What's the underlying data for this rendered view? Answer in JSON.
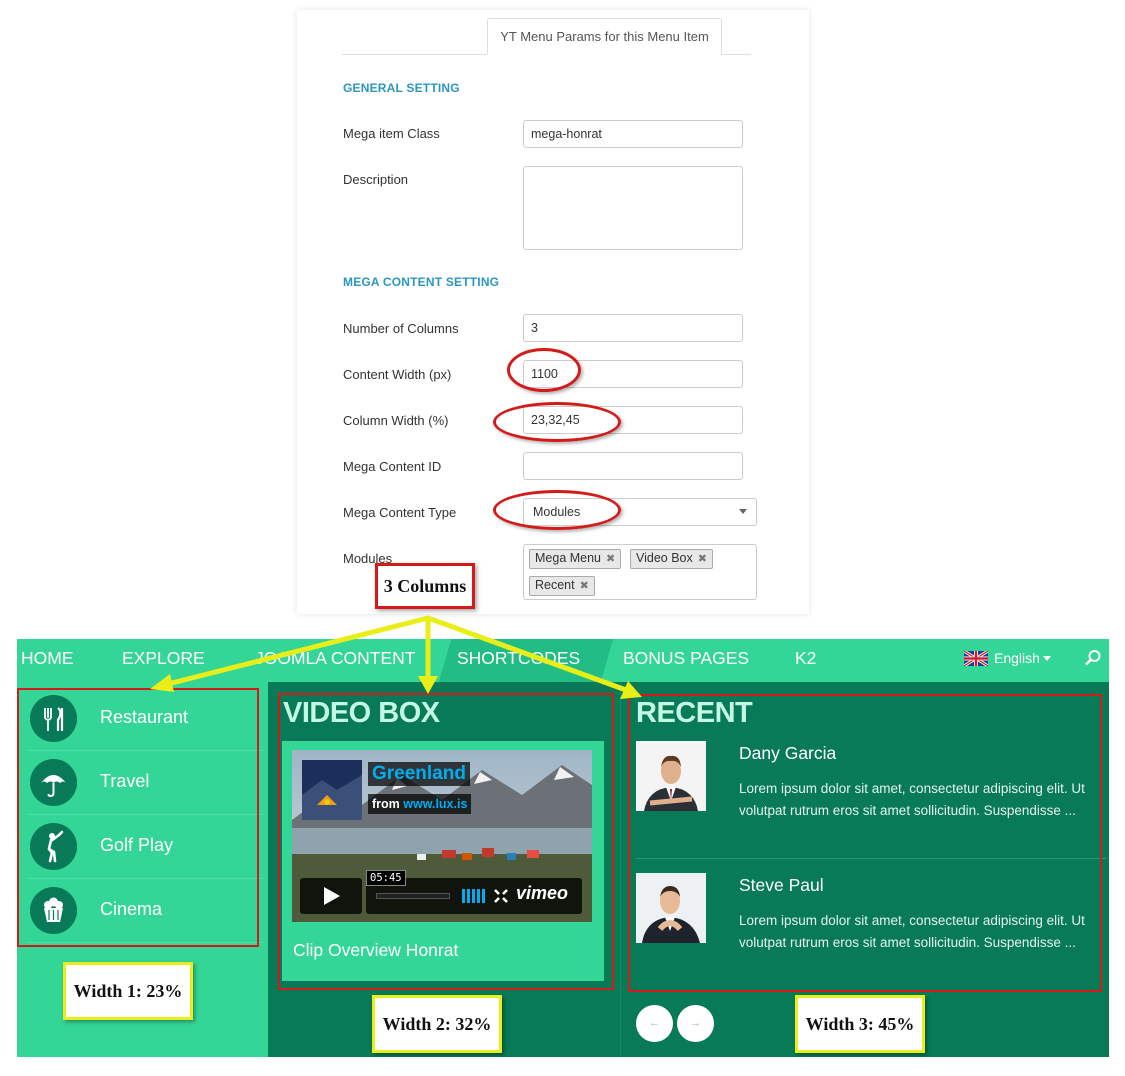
{
  "admin": {
    "tab_label": "YT Menu Params for this Menu Item",
    "general_heading": "GENERAL SETTING",
    "mega_item_class_label": "Mega item Class",
    "mega_item_class_value": "mega-honrat",
    "description_label": "Description",
    "description_value": "",
    "mega_content_heading": "MEGA CONTENT SETTING",
    "num_columns_label": "Number of Columns",
    "num_columns_value": "3",
    "content_width_label": "Content Width (px)",
    "content_width_value": "1100",
    "column_width_label": "Column Width (%)",
    "column_width_value": "23,32,45",
    "mega_content_id_label": "Mega Content ID",
    "mega_content_id_value": "",
    "mega_content_type_label": "Mega Content Type",
    "mega_content_type_value": "Modules",
    "modules_label": "Modules",
    "modules": [
      "Mega Menu",
      "Video Box",
      "Recent"
    ],
    "chip_remove": "✖"
  },
  "annotations": {
    "columns_label": "3 Columns",
    "width1": "Width 1: 23%",
    "width2": "Width 2: 32%",
    "width3": "Width 3: 45%"
  },
  "nav": {
    "items": [
      "HOME",
      "EXPLORE",
      "JOOMLA CONTENT",
      "SHORTCODES",
      "BONUS PAGES",
      "K2"
    ],
    "active_index": 3,
    "language": "English",
    "search_icon": "search-icon"
  },
  "categories": [
    {
      "label": "Restaurant",
      "icon": "cutlery-icon"
    },
    {
      "label": "Travel",
      "icon": "umbrella-icon"
    },
    {
      "label": "Golf Play",
      "icon": "golfer-icon"
    },
    {
      "label": "Cinema",
      "icon": "popcorn-icon"
    }
  ],
  "video_box": {
    "title": "VIDEO BOX",
    "video_title": "Greenland",
    "video_from": "from",
    "video_source": "www.lux.is",
    "video_time": "05:45",
    "player_brand": "vimeo",
    "caption": "Clip Overview Honrat"
  },
  "recent": {
    "title": "RECENT",
    "posts": [
      {
        "name": "Dany Garcia",
        "text": "Lorem ipsum dolor sit amet, consectetur adipiscing elit. Ut volutpat rutrum eros sit amet sollicitudin. Suspendisse ..."
      },
      {
        "name": "Steve Paul",
        "text": "Lorem ipsum dolor sit amet, consectetur adipiscing elit. Ut volutpat rutrum eros sit amet sollicitudin. Suspendisse ..."
      }
    ],
    "prev": "←",
    "next": "→"
  },
  "colors": {
    "nav_green": "#34d698",
    "dark_green": "#087a57",
    "accent_blue": "#2a97c0",
    "annotation_red": "#d51a1a",
    "annotation_yellow": "#e9ee18"
  }
}
